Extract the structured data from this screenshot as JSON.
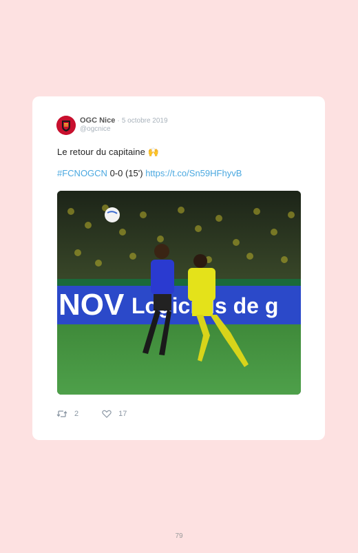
{
  "tweet": {
    "author_name": "OGC Nice",
    "separator": "·",
    "date": "5 octobre 2019",
    "handle": "@ogcnice",
    "text_line1": "Le retour du capitaine",
    "emoji": "🙌",
    "hashtag": "#FCNOGCN",
    "score_text": " 0-0 (15') ",
    "url": "https://t.co/Sn59HFhyvB",
    "retweets": "2",
    "likes": "17"
  },
  "photo": {
    "banner_text_left": "NOV",
    "banner_text_right": "Logiciels de g"
  },
  "page_number": "79",
  "colors": {
    "background": "#fde1e1",
    "link": "#4aa8e0",
    "avatar": "#c8102e"
  }
}
